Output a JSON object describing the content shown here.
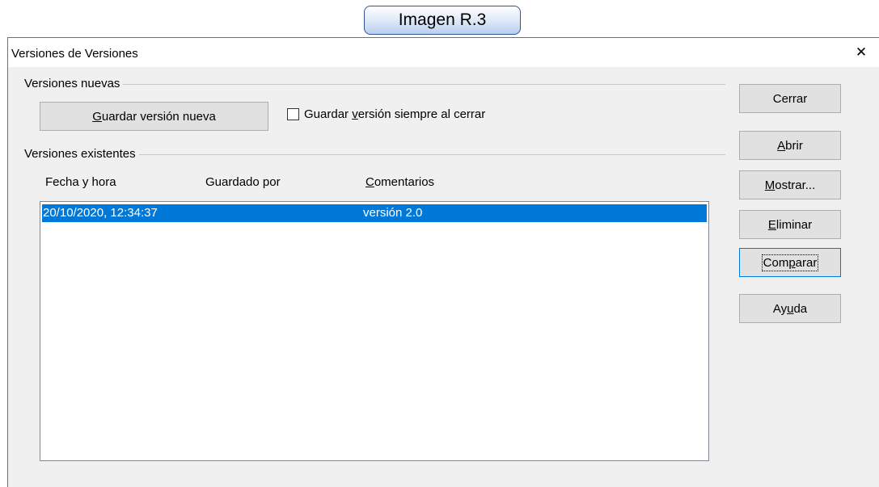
{
  "caption": "Imagen R.3",
  "dialog": {
    "title": "Versiones de Versiones",
    "close_glyph": "✕"
  },
  "new_versions": {
    "section_label": "Versiones nuevas",
    "save_button": {
      "before": "",
      "key": "G",
      "after": "uardar versión nueva"
    },
    "always_save_checkbox": {
      "before": "Guardar ",
      "key": "v",
      "after": "ersión siempre al cerrar",
      "checked": false
    }
  },
  "existing_versions": {
    "section_label": "Versiones existentes",
    "columns": [
      {
        "before": "Fecha y hora",
        "key": "",
        "after": ""
      },
      {
        "before": "Guardado por",
        "key": "",
        "after": ""
      },
      {
        "before": "",
        "key": "C",
        "after": "omentarios"
      }
    ],
    "rows": [
      {
        "date": "20/10/2020, 12:34:37",
        "saved_by": "",
        "comments": "versión 2.0",
        "selected": true
      }
    ]
  },
  "side_buttons": [
    {
      "before": "Cerrar",
      "key": "",
      "after": ""
    },
    {
      "before": "",
      "key": "A",
      "after": "brir"
    },
    {
      "before": "",
      "key": "M",
      "after": "ostrar..."
    },
    {
      "before": "",
      "key": "E",
      "after": "liminar"
    },
    {
      "before": "Com",
      "key": "p",
      "after": "arar"
    },
    {
      "before": "Ay",
      "key": "u",
      "after": "da"
    }
  ],
  "colors": {
    "selection": "#0078d7",
    "dialog_bg": "#f0f0f0",
    "button_bg": "#e1e1e1",
    "caption_border": "#2f5597"
  }
}
